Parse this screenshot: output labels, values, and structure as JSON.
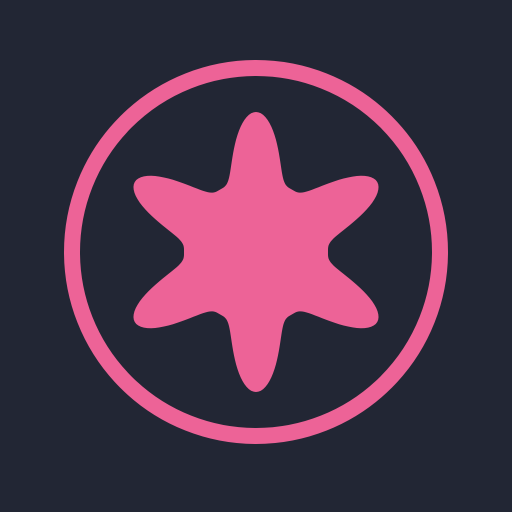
{
  "icon": {
    "name": "six-point-star-badge-icon",
    "background_color": "#222634",
    "foreground_color": "#ED6397",
    "star_points": 6
  }
}
